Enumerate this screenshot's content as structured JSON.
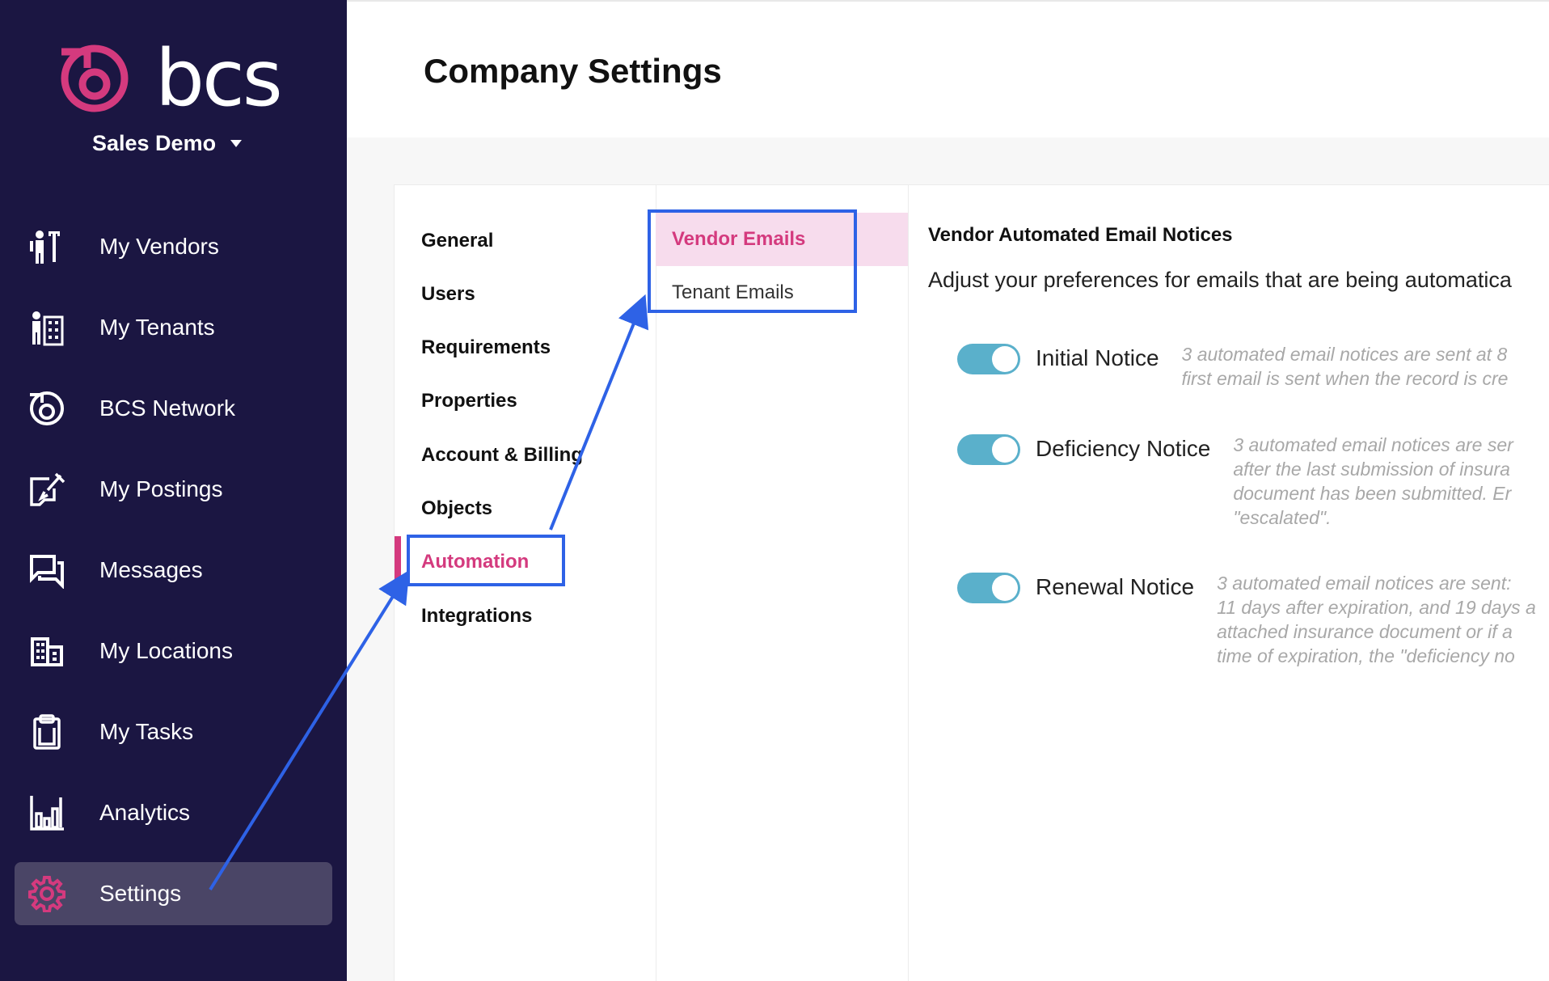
{
  "sidebar": {
    "brand": "bcs",
    "org_name": "Sales Demo",
    "items": [
      {
        "label": "My Vendors",
        "icon": "vendor-icon"
      },
      {
        "label": "My Tenants",
        "icon": "tenant-icon"
      },
      {
        "label": "BCS Network",
        "icon": "network-icon"
      },
      {
        "label": "My Postings",
        "icon": "postings-icon"
      },
      {
        "label": "Messages",
        "icon": "messages-icon"
      },
      {
        "label": "My Locations",
        "icon": "locations-icon"
      },
      {
        "label": "My Tasks",
        "icon": "tasks-icon"
      },
      {
        "label": "Analytics",
        "icon": "analytics-icon"
      },
      {
        "label": "Settings",
        "icon": "gear-icon",
        "active": true
      }
    ]
  },
  "header": {
    "title": "Company Settings"
  },
  "settings_menu": {
    "items": [
      "General",
      "Users",
      "Requirements",
      "Properties",
      "Account & Billing",
      "Objects",
      "Automation",
      "Integrations"
    ],
    "active": "Automation"
  },
  "submenu": {
    "items": [
      "Vendor Emails",
      "Tenant Emails"
    ],
    "active": "Vendor Emails"
  },
  "detail": {
    "title": "Vendor Automated Email Notices",
    "description": "Adjust your preferences for emails that are being automatica",
    "notices": [
      {
        "label": "Initial Notice",
        "enabled": true,
        "text": "3 automated email notices are sent at 8\nfirst email is sent when the record is cre"
      },
      {
        "label": "Deficiency Notice",
        "enabled": true,
        "text": "3 automated email notices are ser\nafter the last submission of insura\ndocument has been submitted. Er\n\"escalated\"."
      },
      {
        "label": "Renewal Notice",
        "enabled": true,
        "text": "3 automated email notices are sent:\n11 days after expiration, and 19 days a\nattached insurance document or if a\ntime of expiration, the \"deficiency no"
      }
    ]
  },
  "colors": {
    "sidebar_bg": "#1b1642",
    "accent_pink": "#d43a7e",
    "toggle_on": "#5ab0cb",
    "annotation_blue": "#2e62e6"
  }
}
